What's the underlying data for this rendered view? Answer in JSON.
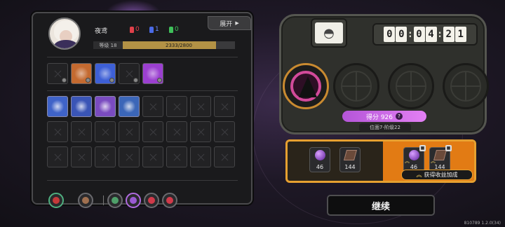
{
  "character": {
    "name": "夜鸢",
    "stats": [
      {
        "color": "#e0404a",
        "value": "0"
      },
      {
        "color": "#4a6ae6",
        "value": "1"
      },
      {
        "color": "#3fc05a",
        "value": "0"
      }
    ],
    "expand_label": "展开",
    "level_label": "等级 18",
    "xp_text": "2333/2800",
    "xp_fraction": 0.833
  },
  "equipment": [
    {
      "name": "empty-slot-1",
      "filled": false
    },
    {
      "name": "flame-head-item",
      "filled": true,
      "color": "#c46a30"
    },
    {
      "name": "lightning-item",
      "filled": true,
      "color": "#3d5fd6"
    },
    {
      "name": "empty-slot-4",
      "filled": false
    },
    {
      "name": "purple-box-item",
      "filled": true,
      "color": "#9b3fd0"
    }
  ],
  "skills": [
    {
      "name": "spark-skill",
      "color": "#3f63c8"
    },
    {
      "name": "orb-skill",
      "color": "#3a55b6"
    },
    {
      "name": "claw-skill",
      "color": "#7a4bc0"
    },
    {
      "name": "swirl-skill",
      "color": "#3b66b8"
    }
  ],
  "bottom_icons": [
    {
      "name": "hero-portrait-icon",
      "color": "#c43a3a"
    },
    {
      "name": "hand-icon",
      "color": "#a07050"
    },
    {
      "name": "green-orb-icon",
      "color": "#4fa06a"
    },
    {
      "name": "purple-orb-icon",
      "color": "#9a5ad2"
    },
    {
      "name": "red-star-icon",
      "color": "#d03a4a"
    },
    {
      "name": "red-gem-icon",
      "color": "#d03a4a"
    }
  ],
  "timer": {
    "h": "00",
    "m": "04",
    "s": "21"
  },
  "score": {
    "label": "得分 926",
    "help": "?"
  },
  "position": {
    "label": "位面7-阶级22"
  },
  "rewards": {
    "base": [
      {
        "name": "purple-orb-reward",
        "color": "#7a3fc2",
        "qty": "46"
      },
      {
        "name": "brown-tile-reward",
        "color": "#6b4a3a",
        "qty": "144"
      }
    ],
    "bonus": [
      {
        "name": "purple-orb-bonus",
        "color": "#7a3fc2",
        "qty": "46"
      },
      {
        "name": "brown-tile-bonus",
        "color": "#6b4a3a",
        "qty": "144"
      }
    ],
    "bonus_label": "获得收益加成"
  },
  "continue_label": "继续",
  "version": "810789 1.2.0(34)"
}
